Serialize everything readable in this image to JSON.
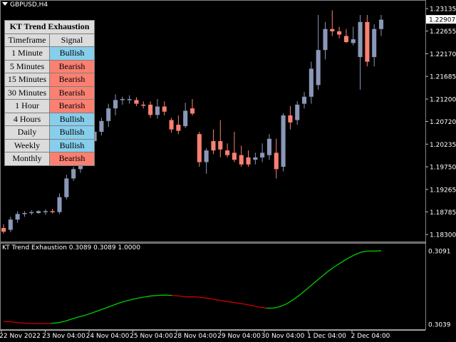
{
  "symbol_label": "GBPUSD,H4",
  "indicator_label": "KT Trend Exhaustion 0.3089 0.3089 1.0000",
  "colors": {
    "bullish": "#87ceeb",
    "bearish": "#fa8072",
    "up_candle": "#8b97b7",
    "down_candle": "#fa8072",
    "line_up": "#00d000",
    "line_down": "#d00000"
  },
  "table": {
    "title": "KT Trend Exhaustion",
    "col_timeframe": "Timeframe",
    "col_signal": "Signal",
    "rows": [
      {
        "timeframe": "1 Minute",
        "signal": "Bullish"
      },
      {
        "timeframe": "5 Minutes",
        "signal": "Bearish"
      },
      {
        "timeframe": "15 Minutes",
        "signal": "Bearish"
      },
      {
        "timeframe": "30 Minutes",
        "signal": "Bearish"
      },
      {
        "timeframe": "1 Hour",
        "signal": "Bearish"
      },
      {
        "timeframe": "4 Hours",
        "signal": "Bullish"
      },
      {
        "timeframe": "Daily",
        "signal": "Bullish"
      },
      {
        "timeframe": "Weekly",
        "signal": "Bullish"
      },
      {
        "timeframe": "Monthly",
        "signal": "Bearish"
      }
    ]
  },
  "chart_data": [
    {
      "type": "candlestick",
      "y_ticks": [
        "1.23135",
        "1.22655",
        "1.22170",
        "1.21685",
        "1.21200",
        "1.20720",
        "1.20235",
        "1.19750",
        "1.19265",
        "1.18785",
        "1.18300"
      ],
      "ylim": [
        1.1818,
        1.2326
      ],
      "current_price": "1.22907",
      "x_ticks": [
        "22 Nov 2022",
        "23 Nov 04:00",
        "24 Nov 04:00",
        "25 Nov 04:00",
        "28 Nov 04:00",
        "29 Nov 04:00",
        "30 Nov 04:00",
        "1 Dec 04:00",
        "2 Dec 04:00"
      ],
      "candles": [
        {
          "o": 1.1844,
          "h": 1.1852,
          "l": 1.1832,
          "c": 1.1836
        },
        {
          "o": 1.184,
          "h": 1.1868,
          "l": 1.1835,
          "c": 1.1862
        },
        {
          "o": 1.1862,
          "h": 1.188,
          "l": 1.1855,
          "c": 1.1874
        },
        {
          "o": 1.1874,
          "h": 1.188,
          "l": 1.1868,
          "c": 1.1876
        },
        {
          "o": 1.1876,
          "h": 1.1882,
          "l": 1.1872,
          "c": 1.1878
        },
        {
          "o": 1.1876,
          "h": 1.1882,
          "l": 1.1874,
          "c": 1.188
        },
        {
          "o": 1.1878,
          "h": 1.1884,
          "l": 1.1872,
          "c": 1.188
        },
        {
          "o": 1.188,
          "h": 1.1885,
          "l": 1.1875,
          "c": 1.1878
        },
        {
          "o": 1.1878,
          "h": 1.1918,
          "l": 1.1874,
          "c": 1.191
        },
        {
          "o": 1.191,
          "h": 1.1958,
          "l": 1.1905,
          "c": 1.195
        },
        {
          "o": 1.195,
          "h": 1.1975,
          "l": 1.1945,
          "c": 1.197
        },
        {
          "o": 1.197,
          "h": 1.2005,
          "l": 1.1962,
          "c": 1.1995
        },
        {
          "o": 1.1995,
          "h": 1.204,
          "l": 1.1985,
          "c": 1.203
        },
        {
          "o": 1.203,
          "h": 1.206,
          "l": 1.202,
          "c": 1.205
        },
        {
          "o": 1.205,
          "h": 1.208,
          "l": 1.2042,
          "c": 1.2073
        },
        {
          "o": 1.2073,
          "h": 1.211,
          "l": 1.206,
          "c": 1.21
        },
        {
          "o": 1.21,
          "h": 1.213,
          "l": 1.2085,
          "c": 1.2118
        },
        {
          "o": 1.2118,
          "h": 1.2125,
          "l": 1.2108,
          "c": 1.212
        },
        {
          "o": 1.212,
          "h": 1.2128,
          "l": 1.211,
          "c": 1.212
        },
        {
          "o": 1.2118,
          "h": 1.2124,
          "l": 1.2105,
          "c": 1.211
        },
        {
          "o": 1.2108,
          "h": 1.2115,
          "l": 1.21,
          "c": 1.2106
        },
        {
          "o": 1.2108,
          "h": 1.2115,
          "l": 1.208,
          "c": 1.2086
        },
        {
          "o": 1.2086,
          "h": 1.212,
          "l": 1.2078,
          "c": 1.2104
        },
        {
          "o": 1.2104,
          "h": 1.2115,
          "l": 1.2085,
          "c": 1.2093
        },
        {
          "o": 1.2075,
          "h": 1.208,
          "l": 1.2048,
          "c": 1.2055
        },
        {
          "o": 1.2065,
          "h": 1.2085,
          "l": 1.2045,
          "c": 1.2052
        },
        {
          "o": 1.2062,
          "h": 1.2112,
          "l": 1.2058,
          "c": 1.2095
        },
        {
          "o": 1.21,
          "h": 1.212,
          "l": 1.2085,
          "c": 1.2089
        },
        {
          "o": 1.2045,
          "h": 1.205,
          "l": 1.1975,
          "c": 1.1985
        },
        {
          "o": 1.1985,
          "h": 1.2015,
          "l": 1.196,
          "c": 1.201
        },
        {
          "o": 1.203,
          "h": 1.2055,
          "l": 1.2002,
          "c": 1.201
        },
        {
          "o": 1.203,
          "h": 1.2075,
          "l": 1.1995,
          "c": 1.2012
        },
        {
          "o": 1.201,
          "h": 1.2025,
          "l": 1.1995,
          "c": 1.2
        },
        {
          "o": 1.2005,
          "h": 1.205,
          "l": 1.1985,
          "c": 1.199
        },
        {
          "o": 1.2,
          "h": 1.202,
          "l": 1.1975,
          "c": 1.198
        },
        {
          "o": 1.1995,
          "h": 1.201,
          "l": 1.1975,
          "c": 1.198
        },
        {
          "o": 1.199,
          "h": 1.2005,
          "l": 1.198,
          "c": 1.1995
        },
        {
          "o": 1.1995,
          "h": 1.2025,
          "l": 1.1985,
          "c": 1.2005
        },
        {
          "o": 1.2,
          "h": 1.2045,
          "l": 1.199,
          "c": 1.2035
        },
        {
          "o": 1.2005,
          "h": 1.2035,
          "l": 1.195,
          "c": 1.197
        },
        {
          "o": 1.1975,
          "h": 1.209,
          "l": 1.1965,
          "c": 1.2085
        },
        {
          "o": 1.2085,
          "h": 1.2105,
          "l": 1.2055,
          "c": 1.207
        },
        {
          "o": 1.2075,
          "h": 1.2115,
          "l": 1.2065,
          "c": 1.2108
        },
        {
          "o": 1.211,
          "h": 1.2135,
          "l": 1.21,
          "c": 1.2125
        },
        {
          "o": 1.2125,
          "h": 1.22,
          "l": 1.211,
          "c": 1.2185
        },
        {
          "o": 1.215,
          "h": 1.23,
          "l": 1.214,
          "c": 1.2225
        },
        {
          "o": 1.2225,
          "h": 1.2285,
          "l": 1.2205,
          "c": 1.227
        },
        {
          "o": 1.227,
          "h": 1.231,
          "l": 1.2255,
          "c": 1.2265
        },
        {
          "o": 1.2265,
          "h": 1.2275,
          "l": 1.225,
          "c": 1.2258
        },
        {
          "o": 1.2255,
          "h": 1.227,
          "l": 1.224,
          "c": 1.2242
        },
        {
          "o": 1.224,
          "h": 1.2275,
          "l": 1.2235,
          "c": 1.2248
        },
        {
          "o": 1.221,
          "h": 1.23,
          "l": 1.214,
          "c": 1.2285
        },
        {
          "o": 1.2285,
          "h": 1.23,
          "l": 1.219,
          "c": 1.22
        },
        {
          "o": 1.221,
          "h": 1.228,
          "l": 1.219,
          "c": 1.227
        },
        {
          "o": 1.227,
          "h": 1.23,
          "l": 1.2255,
          "c": 1.229
        }
      ]
    },
    {
      "type": "line",
      "series_name": "KT Trend Exhaustion",
      "y_ticks": [
        "0.3091",
        "0.3039"
      ],
      "ylim": [
        0.3036,
        0.3094
      ],
      "values": [
        0.3041,
        0.30408,
        0.30402,
        0.30398,
        0.30396,
        0.30394,
        0.30394,
        0.30396,
        0.304,
        0.3041,
        0.30425,
        0.3044,
        0.30452,
        0.30468,
        0.30485,
        0.30502,
        0.3052,
        0.30538,
        0.30553,
        0.30565,
        0.30575,
        0.30584,
        0.30591,
        0.30594,
        0.30596,
        0.30594,
        0.3059,
        0.30584,
        0.30584,
        0.30582,
        0.30576,
        0.30568,
        0.3056,
        0.30552,
        0.30545,
        0.30538,
        0.3053,
        0.3052,
        0.3051,
        0.30504,
        0.30504,
        0.30515,
        0.30535,
        0.30565,
        0.306,
        0.3064,
        0.3068,
        0.3072,
        0.3076,
        0.30795,
        0.30825,
        0.30855,
        0.3088,
        0.309,
        0.30908,
        0.30908,
        0.3091
      ],
      "colors": [
        "down",
        "down",
        "down",
        "down",
        "down",
        "down",
        "down",
        "down",
        "up",
        "up",
        "up",
        "up",
        "up",
        "up",
        "up",
        "up",
        "up",
        "up",
        "up",
        "up",
        "up",
        "up",
        "up",
        "up",
        "up",
        "up",
        "down",
        "down",
        "down",
        "down",
        "down",
        "down",
        "down",
        "down",
        "down",
        "down",
        "down",
        "down",
        "down",
        "down",
        "up",
        "up",
        "up",
        "up",
        "up",
        "up",
        "up",
        "up",
        "up",
        "up",
        "up",
        "up",
        "up",
        "up",
        "up",
        "up",
        "up"
      ]
    }
  ]
}
